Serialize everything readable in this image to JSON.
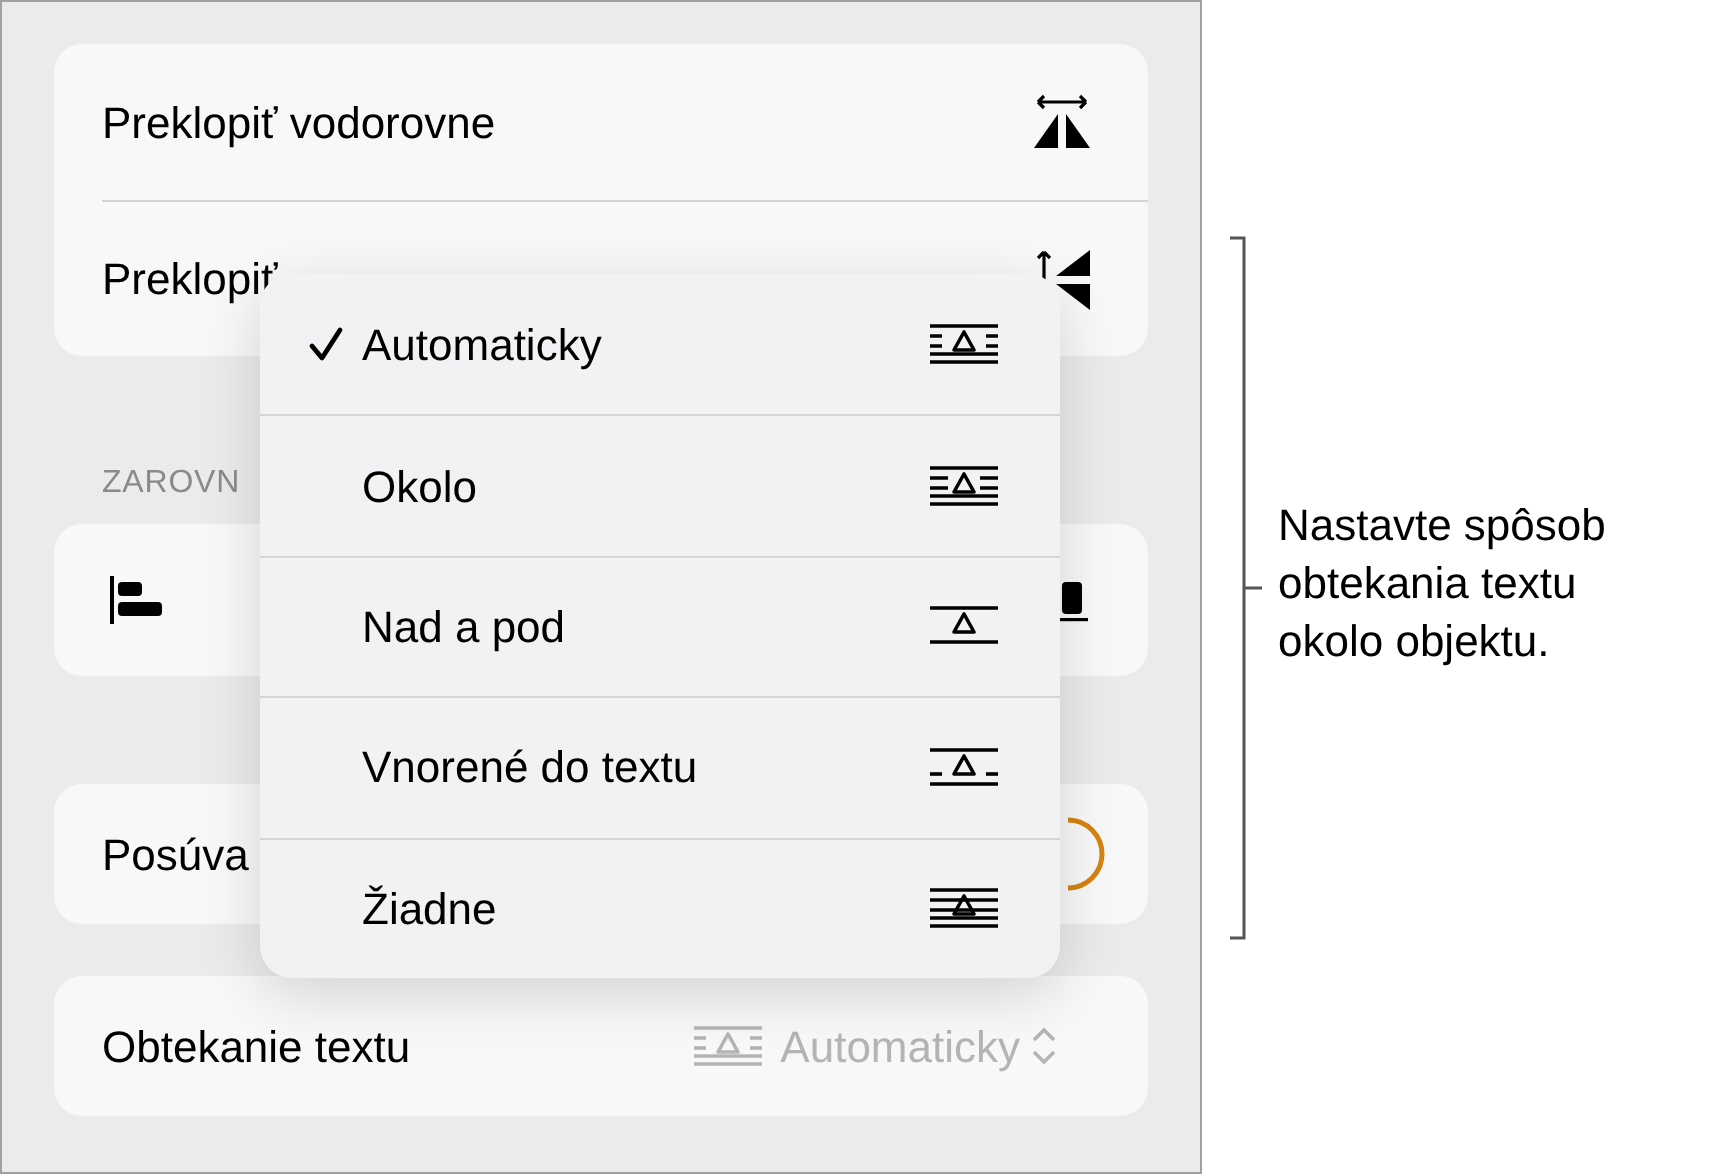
{
  "flip_card": {
    "items": [
      {
        "label": "Preklopiť vodorovne",
        "kind": "horizontal"
      },
      {
        "label": "Preklopiť",
        "kind": "vertical"
      }
    ]
  },
  "section_label": "ZAROVN",
  "move_row": {
    "label": "Posúva"
  },
  "wrap_row": {
    "label": "Obtekanie textu",
    "value": "Automaticky"
  },
  "wrap_menu": {
    "items": [
      {
        "label": "Automaticky",
        "kind": "automatic",
        "selected": true
      },
      {
        "label": "Okolo",
        "kind": "around",
        "selected": false
      },
      {
        "label": "Nad a pod",
        "kind": "above-below",
        "selected": false
      },
      {
        "label": "Vnorené do textu",
        "kind": "inline",
        "selected": false
      },
      {
        "label": "Žiadne",
        "kind": "none",
        "selected": false
      }
    ]
  },
  "callout": {
    "text": "Nastavte spôsob obtekania textu okolo objektu."
  }
}
